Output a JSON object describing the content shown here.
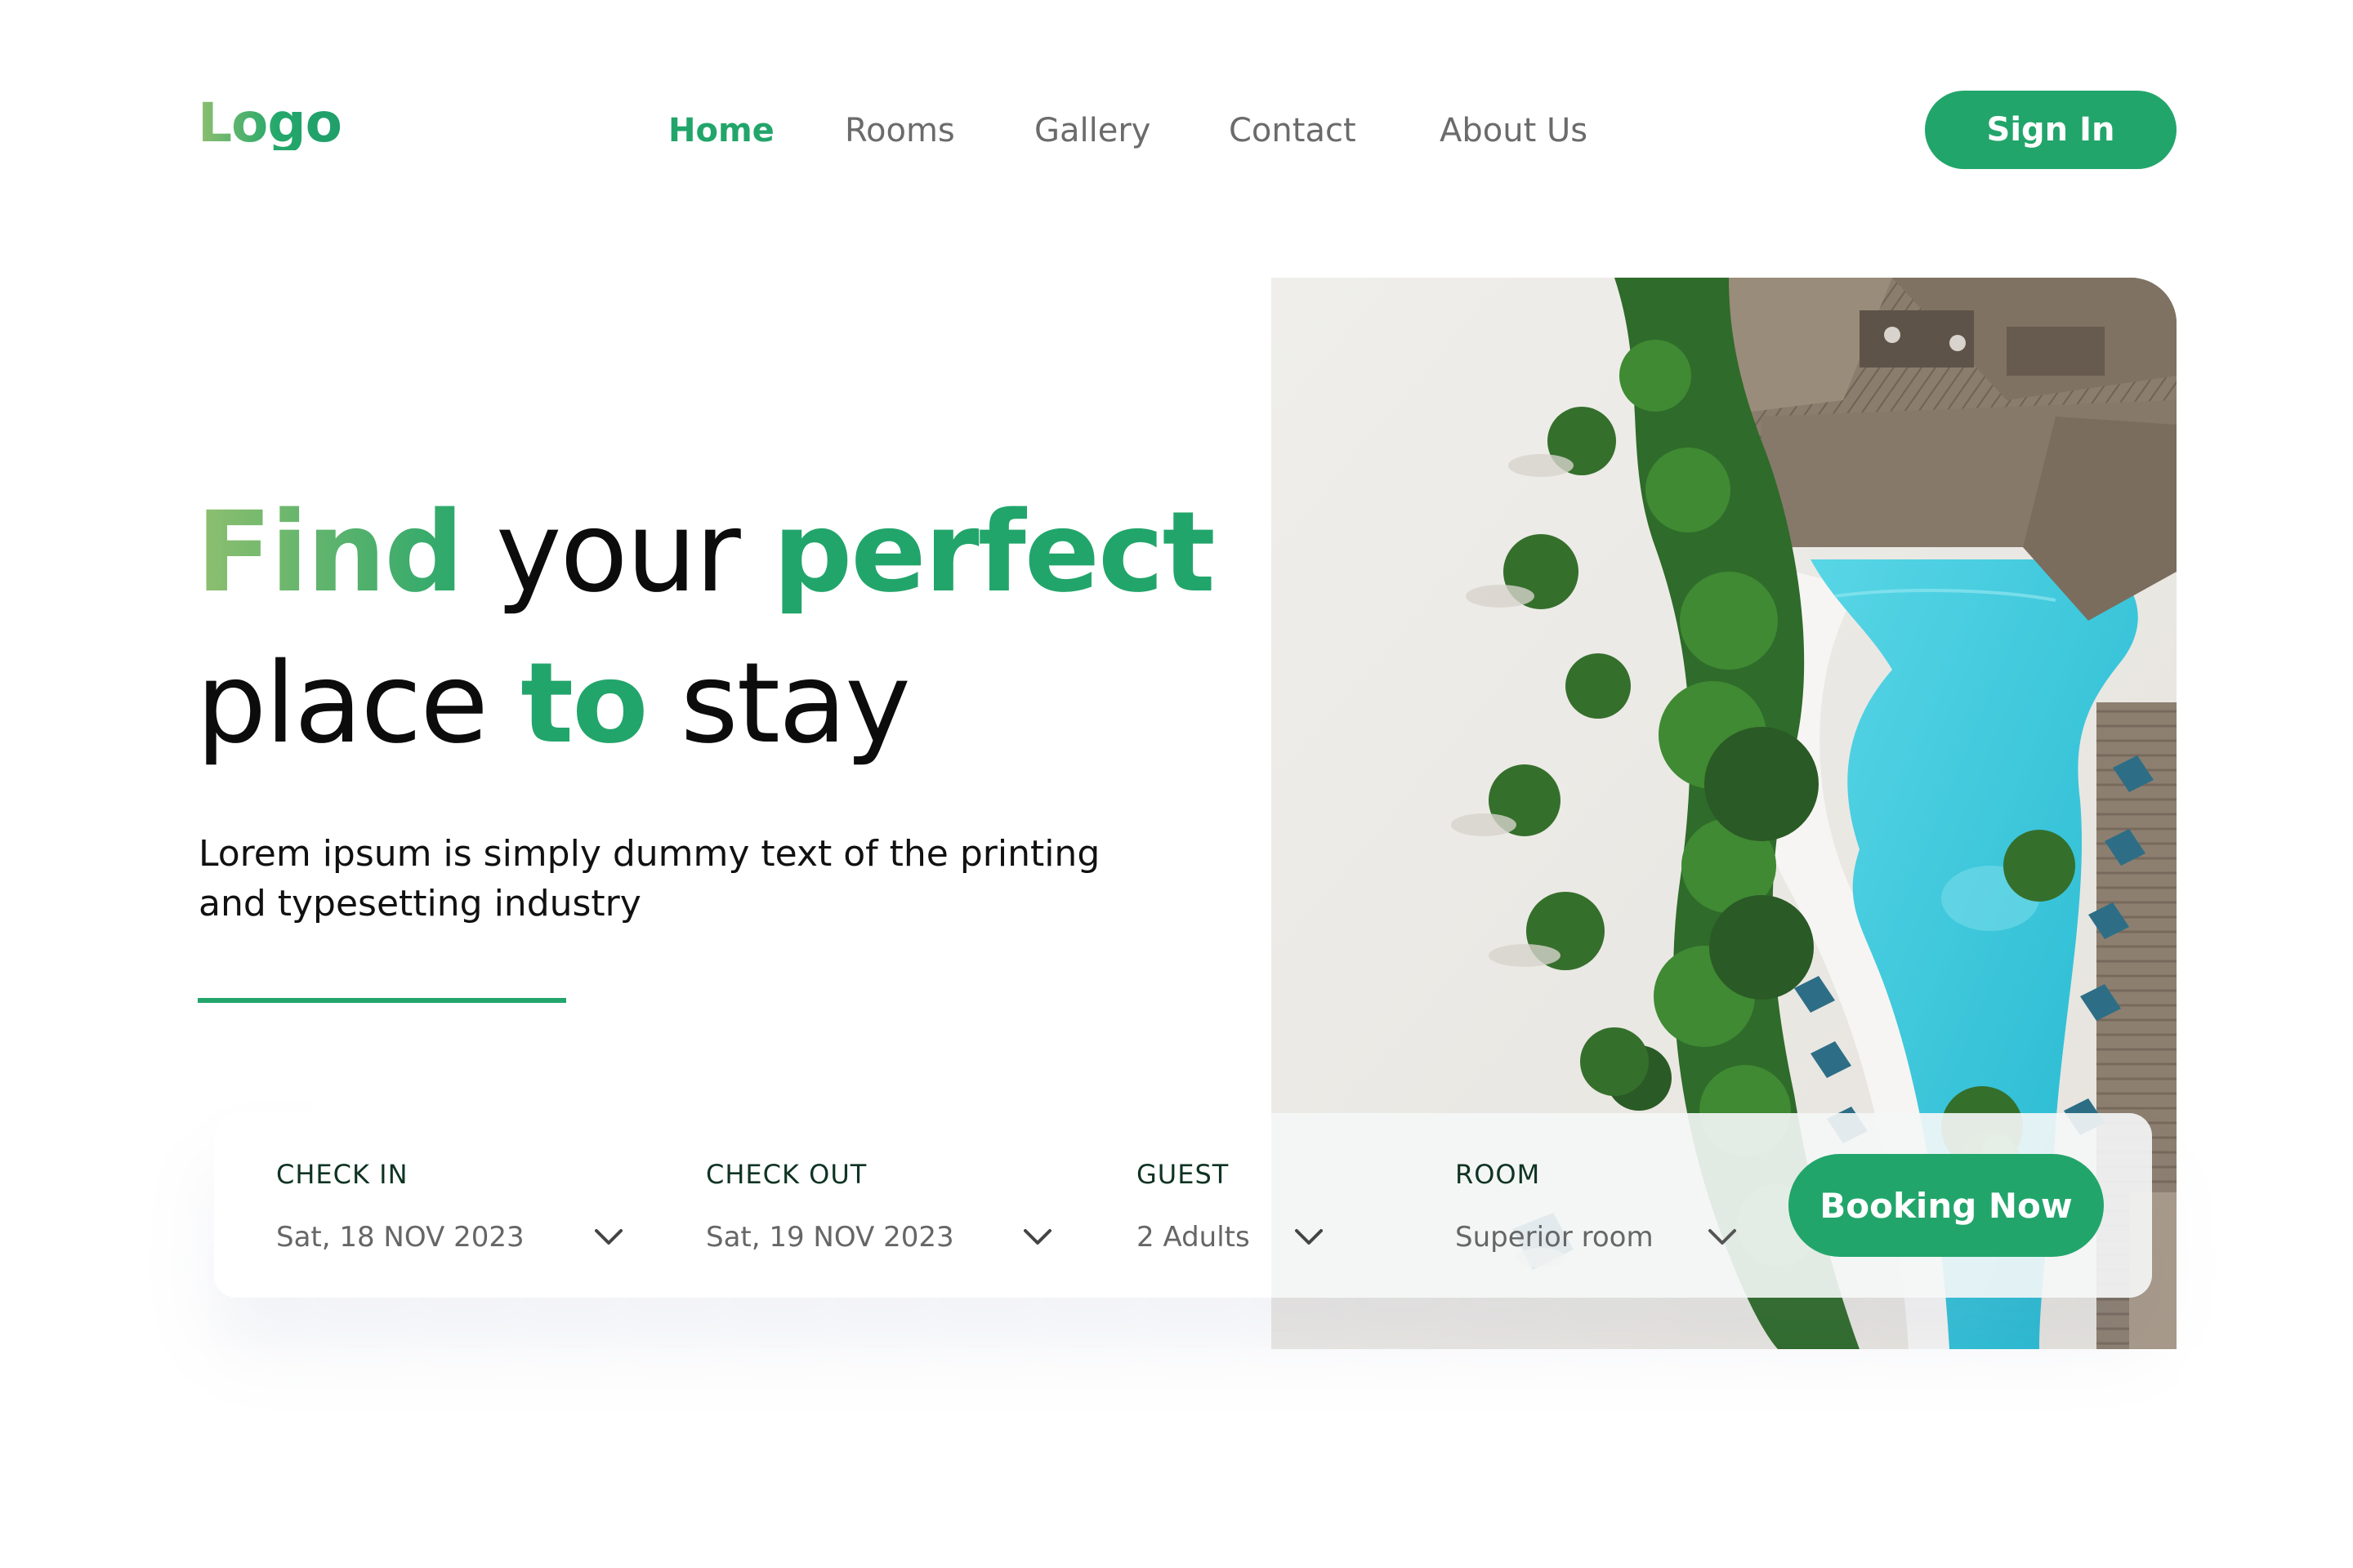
{
  "header": {
    "logo": "Logo",
    "nav": [
      {
        "label": "Home",
        "active": true
      },
      {
        "label": "Rooms",
        "active": false
      },
      {
        "label": "Gallery",
        "active": false
      },
      {
        "label": "Contact",
        "active": false
      },
      {
        "label": "About Us",
        "active": false
      }
    ],
    "sign_in_label": "Sign In"
  },
  "hero": {
    "headline": {
      "word1": "Find",
      "word2": "your",
      "word3": "perfect",
      "word4": "place",
      "word5": "to",
      "word6": "stay"
    },
    "subtext": "Lorem ipsum is simply dummy text of the printing and typesetting industry",
    "image_icon": "resort-pool-aerial-image"
  },
  "booking": {
    "fields": [
      {
        "label": "CHECK IN",
        "value": "Sat, 18 NOV 2023",
        "icon": "chevron-down-icon"
      },
      {
        "label": "CHECK OUT",
        "value": "Sat, 19 NOV 2023",
        "icon": "chevron-down-icon"
      },
      {
        "label": "GUEST",
        "value": "2 Adults",
        "icon": "chevron-down-icon"
      },
      {
        "label": "ROOM",
        "value": "Superior room",
        "icon": "chevron-down-icon"
      }
    ],
    "button_label": "Booking Now"
  },
  "colors": {
    "accent": "#22a56b",
    "accent_light": "#8fbf6f",
    "text_dark": "#0c0c0c",
    "nav_text": "#6b6b6b",
    "pool": "#3cc8dc"
  }
}
